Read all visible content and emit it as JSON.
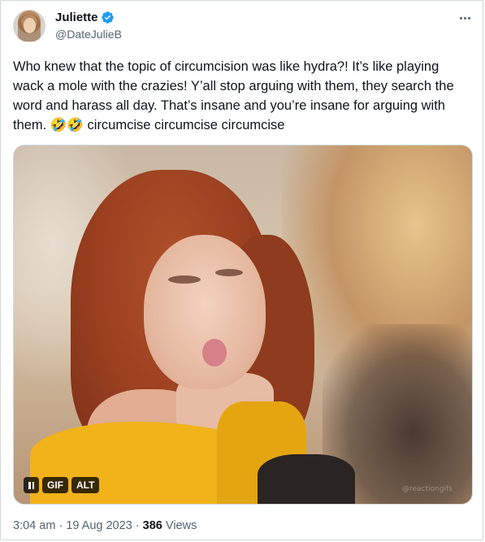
{
  "author": {
    "name": "Juliette",
    "handle": "@DateJulieB"
  },
  "tweet": {
    "text": "Who knew that the topic of circumcision was like hydra?! It’s like playing wack a mole with the crazies! Y’all stop arguing with them, they search the word and harass all day. That’s insane and you’re insane for arguing with them. 🤣🤣 circumcise circumcise circumcise"
  },
  "media": {
    "badges": {
      "gif_label": "GIF",
      "alt_label": "ALT"
    },
    "watermark": "@reactiongifs"
  },
  "meta": {
    "time": "3:04 am",
    "separator": "·",
    "date": "19 Aug 2023",
    "views_count": "386",
    "views_label": "Views"
  },
  "icons": {
    "verified": "verified-badge-icon",
    "more": "more-horizontal-icon",
    "pause": "pause-icon"
  },
  "colors": {
    "verified_blue": "#1d9bf0",
    "secondary_text": "#536471",
    "primary_text": "#0f1419",
    "border": "#cfd9de"
  }
}
